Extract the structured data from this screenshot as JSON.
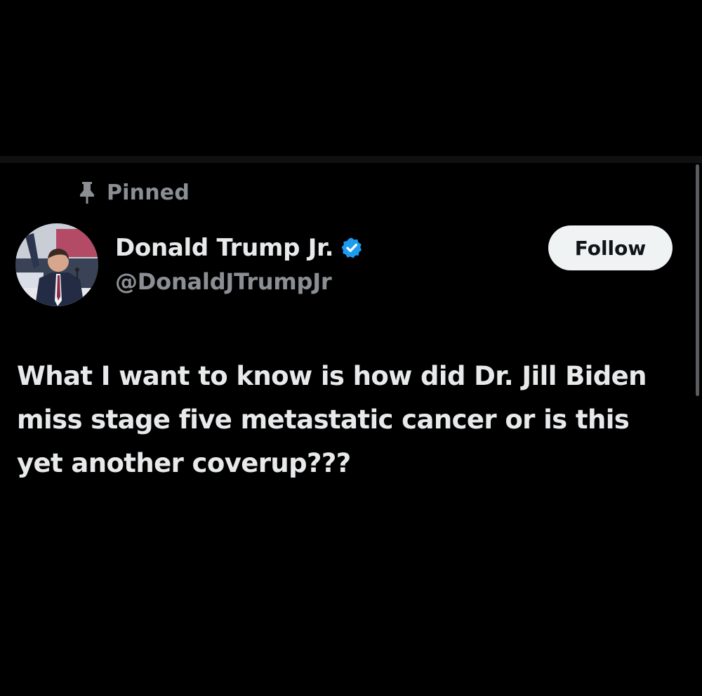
{
  "pinned": {
    "icon": "pin-icon",
    "label": "Pinned"
  },
  "author": {
    "display_name": "Donald Trump Jr.",
    "handle": "@DonaldJTrumpJr",
    "verified_icon": "verified-badge-icon",
    "verified_color": "#1d9bf0"
  },
  "follow_button": {
    "label": "Follow"
  },
  "tweet": {
    "lines": [
      "What I want to know is how did Dr. Jill Biden",
      "miss stage five metastatic cancer or is this",
      "yet another coverup???"
    ]
  },
  "colors": {
    "background": "#000000",
    "text_primary": "#e7e9ea",
    "text_secondary": "#8b8f94",
    "button_background": "#eff3f4",
    "button_text": "#0f1419"
  }
}
